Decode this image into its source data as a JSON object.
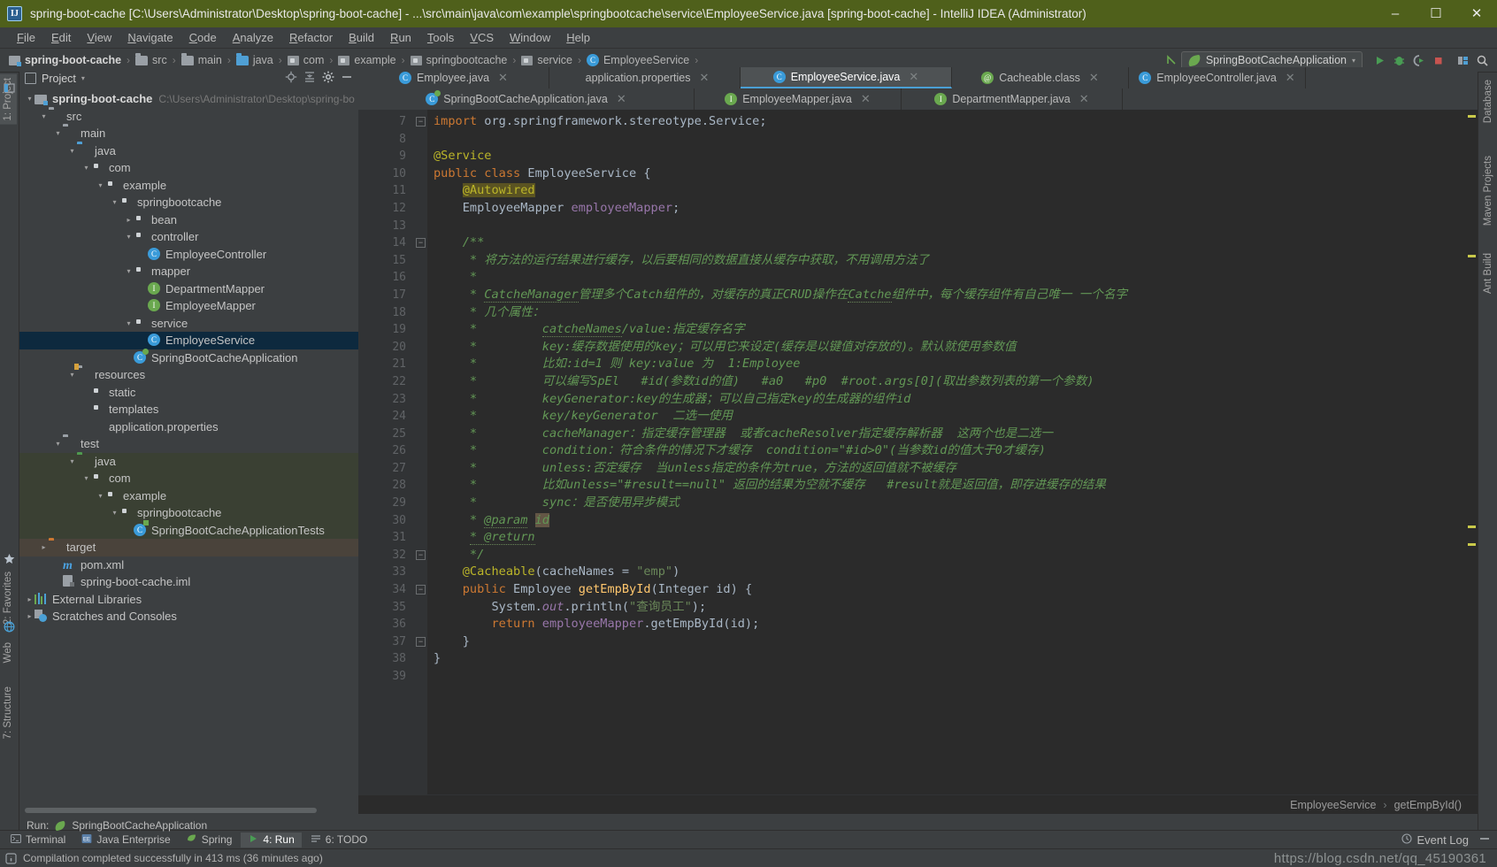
{
  "window": {
    "title": "spring-boot-cache [C:\\Users\\Administrator\\Desktop\\spring-boot-cache] - ...\\src\\main\\java\\com\\example\\springbootcache\\service\\EmployeeService.java [spring-boot-cache] - IntelliJ IDEA (Administrator)",
    "app_icon_text": "IJ",
    "minimize": "–",
    "maximize": "☐",
    "close": "✕",
    "titlebar_color": "#4f601b"
  },
  "menubar": {
    "items": [
      "File",
      "Edit",
      "View",
      "Navigate",
      "Code",
      "Analyze",
      "Refactor",
      "Build",
      "Run",
      "Tools",
      "VCS",
      "Window",
      "Help"
    ]
  },
  "navbar": {
    "crumbs": [
      "spring-boot-cache",
      "src",
      "main",
      "java",
      "com",
      "example",
      "springbootcache",
      "service",
      "EmployeeService"
    ],
    "separator": "›",
    "run_config": "SpringBootCacheApplication",
    "run_config_caret": "▾",
    "icons": [
      "back-arrow-icon",
      "run-icon",
      "debug-icon",
      "run-coverage-icon",
      "stop-icon",
      "project-structure-icon",
      "search-everywhere-icon"
    ]
  },
  "left_strip": {
    "top": "1: Project",
    "items": [
      "2: Favorites",
      "7: Structure"
    ],
    "web_label": "Web"
  },
  "right_strip": {
    "items": [
      "Database",
      "Maven Projects",
      "Ant Build"
    ]
  },
  "project_panel": {
    "title": "Project",
    "caret": "▾",
    "actions": [
      "locate-icon",
      "collapse-all-icon",
      "settings-gear-icon",
      "hide-icon"
    ],
    "tree": [
      {
        "indent": 0,
        "arrow": "▾",
        "icon": "module-icon",
        "label": "spring-boot-cache",
        "sub": "C:\\Users\\Administrator\\Desktop\\spring-bo",
        "bold": true,
        "bg": "none"
      },
      {
        "indent": 1,
        "arrow": "▾",
        "icon": "folder-icon",
        "label": "src",
        "sub": "",
        "bold": false,
        "bg": "none"
      },
      {
        "indent": 2,
        "arrow": "▾",
        "icon": "folder-icon",
        "label": "main",
        "sub": "",
        "bold": false,
        "bg": "none"
      },
      {
        "indent": 3,
        "arrow": "▾",
        "icon": "folder-blue-icon",
        "label": "java",
        "sub": "",
        "bold": false,
        "bg": "none"
      },
      {
        "indent": 4,
        "arrow": "▾",
        "icon": "package-icon",
        "label": "com",
        "sub": "",
        "bold": false,
        "bg": "none"
      },
      {
        "indent": 5,
        "arrow": "▾",
        "icon": "package-icon",
        "label": "example",
        "sub": "",
        "bold": false,
        "bg": "none"
      },
      {
        "indent": 6,
        "arrow": "▾",
        "icon": "package-icon",
        "label": "springbootcache",
        "sub": "",
        "bold": false,
        "bg": "none"
      },
      {
        "indent": 7,
        "arrow": "▸",
        "icon": "package-icon",
        "label": "bean",
        "sub": "",
        "bold": false,
        "bg": "none"
      },
      {
        "indent": 7,
        "arrow": "▾",
        "icon": "package-icon",
        "label": "controller",
        "sub": "",
        "bold": false,
        "bg": "none"
      },
      {
        "indent": 8,
        "arrow": "",
        "icon": "class-icon",
        "label": "EmployeeController",
        "sub": "",
        "bold": false,
        "bg": "none"
      },
      {
        "indent": 7,
        "arrow": "▾",
        "icon": "package-icon",
        "label": "mapper",
        "sub": "",
        "bold": false,
        "bg": "none"
      },
      {
        "indent": 8,
        "arrow": "",
        "icon": "interface-icon",
        "label": "DepartmentMapper",
        "sub": "",
        "bold": false,
        "bg": "none"
      },
      {
        "indent": 8,
        "arrow": "",
        "icon": "interface-icon",
        "label": "EmployeeMapper",
        "sub": "",
        "bold": false,
        "bg": "none"
      },
      {
        "indent": 7,
        "arrow": "▾",
        "icon": "package-icon",
        "label": "service",
        "sub": "",
        "bold": false,
        "bg": "none"
      },
      {
        "indent": 8,
        "arrow": "",
        "icon": "class-icon",
        "label": "EmployeeService",
        "sub": "",
        "bold": false,
        "bg": "selected"
      },
      {
        "indent": 7,
        "arrow": "",
        "icon": "spring-class-icon",
        "label": "SpringBootCacheApplication",
        "sub": "",
        "bold": false,
        "bg": "none"
      },
      {
        "indent": 3,
        "arrow": "▾",
        "icon": "resources-folder-icon",
        "label": "resources",
        "sub": "",
        "bold": false,
        "bg": "none"
      },
      {
        "indent": 4,
        "arrow": "",
        "icon": "package-icon",
        "label": "static",
        "sub": "",
        "bold": false,
        "bg": "none"
      },
      {
        "indent": 4,
        "arrow": "",
        "icon": "package-icon",
        "label": "templates",
        "sub": "",
        "bold": false,
        "bg": "none"
      },
      {
        "indent": 4,
        "arrow": "",
        "icon": "spring-properties-icon",
        "label": "application.properties",
        "sub": "",
        "bold": false,
        "bg": "none"
      },
      {
        "indent": 2,
        "arrow": "▾",
        "icon": "folder-icon",
        "label": "test",
        "sub": "",
        "bold": false,
        "bg": "none"
      },
      {
        "indent": 3,
        "arrow": "▾",
        "icon": "folder-green-icon",
        "label": "java",
        "sub": "",
        "bold": false,
        "bg": "test"
      },
      {
        "indent": 4,
        "arrow": "▾",
        "icon": "package-icon",
        "label": "com",
        "sub": "",
        "bold": false,
        "bg": "test"
      },
      {
        "indent": 5,
        "arrow": "▾",
        "icon": "package-icon",
        "label": "example",
        "sub": "",
        "bold": false,
        "bg": "test"
      },
      {
        "indent": 6,
        "arrow": "▾",
        "icon": "package-icon",
        "label": "springbootcache",
        "sub": "",
        "bold": false,
        "bg": "test"
      },
      {
        "indent": 7,
        "arrow": "",
        "icon": "test-class-icon",
        "label": "SpringBootCacheApplicationTests",
        "sub": "",
        "bold": false,
        "bg": "test"
      },
      {
        "indent": 1,
        "arrow": "▸",
        "icon": "folder-orange-icon",
        "label": "target",
        "sub": "",
        "bold": false,
        "bg": "target"
      },
      {
        "indent": 2,
        "arrow": "",
        "icon": "maven-icon",
        "label": "pom.xml",
        "sub": "",
        "bold": false,
        "bg": "none"
      },
      {
        "indent": 2,
        "arrow": "",
        "icon": "iml-icon",
        "label": "spring-boot-cache.iml",
        "sub": "",
        "bold": false,
        "bg": "none"
      },
      {
        "indent": 0,
        "arrow": "▸",
        "icon": "libraries-icon",
        "label": "External Libraries",
        "sub": "",
        "bold": false,
        "bg": "none"
      },
      {
        "indent": 0,
        "arrow": "▸",
        "icon": "scratches-icon",
        "label": "Scratches and Consoles",
        "sub": "",
        "bold": false,
        "bg": "none"
      }
    ]
  },
  "editor": {
    "tabs_row1": [
      {
        "label": "Employee.java",
        "icon": "class-icon",
        "active": false,
        "closable": true
      },
      {
        "label": "application.properties",
        "icon": "spring-properties-icon",
        "active": false,
        "closable": true
      },
      {
        "label": "EmployeeService.java",
        "icon": "class-icon",
        "active": true,
        "closable": true
      },
      {
        "label": "Cacheable.class",
        "icon": "annotation-class-icon",
        "active": false,
        "closable": true
      },
      {
        "label": "EmployeeController.java",
        "icon": "class-icon",
        "active": false,
        "closable": true
      }
    ],
    "tabs_row2": [
      {
        "label": "SpringBootCacheApplication.java",
        "icon": "spring-class-icon",
        "active": false,
        "closable": true
      },
      {
        "label": "EmployeeMapper.java",
        "icon": "interface-icon",
        "active": false,
        "closable": true
      },
      {
        "label": "DepartmentMapper.java",
        "icon": "interface-icon",
        "active": false,
        "closable": true
      }
    ],
    "first_line_number": 7,
    "lines": [
      {
        "n": 7,
        "fold": "minus",
        "gmark": "",
        "html": "<span class=\"kw\">import</span> <span class=\"plain\">org.springframework.stereotype.</span><span class=\"cls\">Service</span><span class=\"plain\">;</span>"
      },
      {
        "n": 8,
        "fold": "",
        "gmark": "",
        "html": ""
      },
      {
        "n": 9,
        "fold": "",
        "gmark": "spring-bean-icon",
        "html": "<span class=\"ann\">@Service</span>"
      },
      {
        "n": 10,
        "fold": "",
        "gmark": "spring-class-marker-icon",
        "html": "<span class=\"kw\">public class</span> <span class=\"cls\">EmployeeService</span> <span class=\"plain\">{</span>"
      },
      {
        "n": 11,
        "fold": "",
        "gmark": "",
        "html": "    <span class=\"ann hl\">@Autowired</span>"
      },
      {
        "n": 12,
        "fold": "",
        "gmark": "autowired-icon",
        "html": "    <span class=\"cls\">EmployeeMapper</span> <span class=\"fld\">employeeMapper</span><span class=\"plain\">;</span>"
      },
      {
        "n": 13,
        "fold": "",
        "gmark": "",
        "html": ""
      },
      {
        "n": 14,
        "fold": "minus",
        "gmark": "",
        "html": "    <span class=\"cmt\">/**</span>"
      },
      {
        "n": 15,
        "fold": "",
        "gmark": "",
        "html": "     <span class=\"cmt\">* 将方法的运行结果进行缓存，以后要相同的数据直接从缓存中获取，不用调用方法了</span>"
      },
      {
        "n": 16,
        "fold": "",
        "gmark": "",
        "html": "     <span class=\"cmt\">*</span>"
      },
      {
        "n": 17,
        "fold": "",
        "gmark": "",
        "html": "     <span class=\"cmt\">* <span class=\"undl\">CatcheManager</span>管理多个Catch组件的，对缓存的真正CRUD操作在<span class=\"undl\">Catche</span>组件中，每个缓存组件有自己唯一 一个名字</span>"
      },
      {
        "n": 18,
        "fold": "",
        "gmark": "",
        "html": "     <span class=\"cmt\">* 几个属性：</span>"
      },
      {
        "n": 19,
        "fold": "",
        "gmark": "",
        "html": "     <span class=\"cmt\">*         <span class=\"undl\">catcheNames</span>/value:指定缓存名字</span>"
      },
      {
        "n": 20,
        "fold": "",
        "gmark": "",
        "html": "     <span class=\"cmt\">*         key:缓存数据使用的key；可以用它来设定(缓存是以键值对存放的)。默认就使用参数值</span>"
      },
      {
        "n": 21,
        "fold": "",
        "gmark": "",
        "html": "     <span class=\"cmt\">*         比如:id=1 则 key:value 为  1:Employee</span>"
      },
      {
        "n": 22,
        "fold": "",
        "gmark": "",
        "html": "     <span class=\"cmt\">*         可以编写SpEl   #id(参数id的值)   #a0   #p0  #root.args[0](取出参数列表的第一个参数)</span>"
      },
      {
        "n": 23,
        "fold": "",
        "gmark": "",
        "html": "     <span class=\"cmt\">*         keyGenerator:key的生成器；可以自己指定key的生成器的组件id</span>"
      },
      {
        "n": 24,
        "fold": "",
        "gmark": "",
        "html": "     <span class=\"cmt\">*         key/keyGenerator  二选一使用</span>"
      },
      {
        "n": 25,
        "fold": "",
        "gmark": "",
        "html": "     <span class=\"cmt\">*         cacheManager：指定缓存管理器  或者cacheResolver指定缓存解析器  这两个也是二选一</span>"
      },
      {
        "n": 26,
        "fold": "",
        "gmark": "",
        "html": "     <span class=\"cmt\">*         condition：符合条件的情况下才缓存  condition=\"#id&gt;0\"(当参数id的值大于0才缓存)</span>"
      },
      {
        "n": 27,
        "fold": "",
        "gmark": "",
        "html": "     <span class=\"cmt\">*         unless:否定缓存  当unless指定的条件为true，方法的返回值就不被缓存</span>"
      },
      {
        "n": 28,
        "fold": "",
        "gmark": "",
        "html": "     <span class=\"cmt\">*         比如unless=\"#result==null\" 返回的结果为空就不缓存   #result就是返回值，即存进缓存的结果</span>"
      },
      {
        "n": 29,
        "fold": "",
        "gmark": "intention-bulb-icon",
        "html": "     <span class=\"cmt\">*         sync：是否使用异步模式</span>"
      },
      {
        "n": 30,
        "fold": "",
        "gmark": "",
        "html": "     <span class=\"cmt\">* <span class=\"undl\">@param</span> <span class=\"hl2\">id</span></span>"
      },
      {
        "n": 31,
        "fold": "",
        "gmark": "",
        "html": "     <span class=\"cmt\"><span class=\"undl\">* @return</span></span>"
      },
      {
        "n": 32,
        "fold": "minus",
        "gmark": "",
        "html": "     <span class=\"cmt\">*/</span>"
      },
      {
        "n": 33,
        "fold": "",
        "gmark": "",
        "html": "    <span class=\"ann\">@Cacheable</span><span class=\"plain\">(</span><span class=\"plain\">cacheNames</span> <span class=\"plain\">=</span> <span class=\"str\">\"emp\"</span><span class=\"plain\">)</span>"
      },
      {
        "n": 34,
        "fold": "minus",
        "gmark": "",
        "html": "    <span class=\"kw\">public</span> <span class=\"cls\">Employee</span> <span class=\"mth\">getEmpById</span><span class=\"plain\">(</span><span class=\"cls\">Integer</span> <span class=\"plain\">id</span><span class=\"plain\">) {</span>"
      },
      {
        "n": 35,
        "fold": "",
        "gmark": "",
        "html": "        <span class=\"cls\">System</span><span class=\"plain\">.</span><span class=\"fld\" style=\"font-style:italic\">out</span><span class=\"plain\">.println(</span><span class=\"str\">\"查询员工\"</span><span class=\"plain\">);</span>"
      },
      {
        "n": 36,
        "fold": "",
        "gmark": "",
        "html": "        <span class=\"kw\">return</span> <span class=\"fld\">employeeMapper</span><span class=\"plain\">.getEmpById(id);</span>"
      },
      {
        "n": 37,
        "fold": "minus",
        "gmark": "",
        "html": "    <span class=\"plain\">}</span>"
      },
      {
        "n": 38,
        "fold": "",
        "gmark": "",
        "html": "<span class=\"plain\">}</span>"
      },
      {
        "n": 39,
        "fold": "",
        "gmark": "",
        "html": ""
      }
    ],
    "breadcrumb": [
      "EmployeeService",
      "getEmpById()"
    ],
    "breadcrumb_sep": "›"
  },
  "bottom_bar": {
    "run_label": "Run:",
    "run_config": "SpringBootCacheApplication",
    "tabs": [
      {
        "label": "Terminal",
        "icon": "terminal-icon",
        "active": false
      },
      {
        "label": "Java Enterprise",
        "icon": "java-ee-icon",
        "active": false
      },
      {
        "label": "Spring",
        "icon": "spring-icon",
        "active": false
      },
      {
        "label": "4: Run",
        "icon": "run-icon",
        "active": true
      },
      {
        "label": "6: TODO",
        "icon": "todo-icon",
        "active": false
      }
    ],
    "event_log": "Event Log",
    "event_log_icon": "event-log-icon"
  },
  "status_bar": {
    "message": "Compilation completed successfully in 413 ms (36 minutes ago)",
    "icon": "info-icon",
    "watermark": "https://blog.csdn.net/qq_45190361"
  }
}
